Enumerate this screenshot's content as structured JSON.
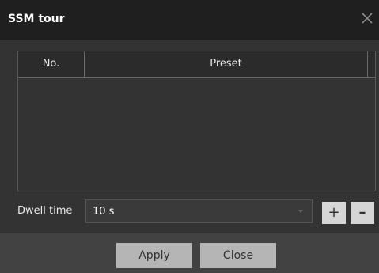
{
  "window": {
    "title": "SSM tour"
  },
  "table": {
    "columns": [
      "No.",
      "Preset"
    ],
    "rows": []
  },
  "dwell_time": {
    "label": "Dwell time",
    "value": "10 s"
  },
  "controls": {
    "plus": "+",
    "minus": "–"
  },
  "footer": {
    "apply_label": "Apply",
    "close_label": "Close"
  },
  "colors": {
    "titlebar_bg": "#1f1f1f",
    "panel_bg": "#333333",
    "footer_bg": "#424242",
    "button_bg": "#b5b5b5"
  },
  "icons": {
    "close": "close-icon",
    "dropdown": "chevron-down-icon"
  }
}
